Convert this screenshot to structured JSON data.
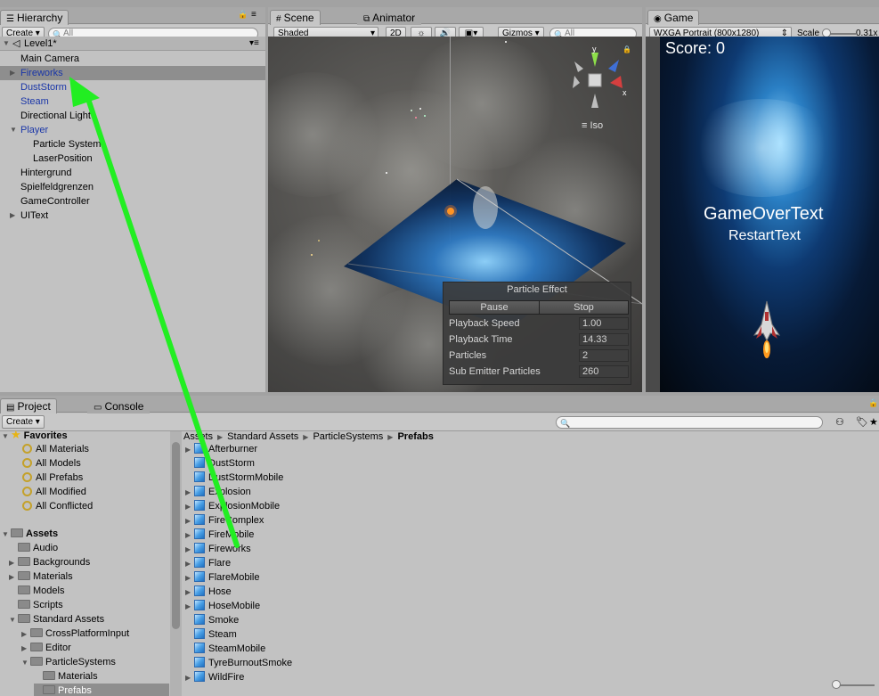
{
  "hierarchy": {
    "tab": "Hierarchy",
    "create": "Create",
    "search_placeholder": "All",
    "scene_name": "Level1*",
    "items": [
      {
        "label": "Main Camera",
        "indent": 0,
        "arrow": "",
        "color": "black"
      },
      {
        "label": "Fireworks",
        "indent": 0,
        "arrow": "right",
        "color": "blue",
        "selected": true
      },
      {
        "label": "DustStorm",
        "indent": 0,
        "arrow": "",
        "color": "blue"
      },
      {
        "label": "Steam",
        "indent": 0,
        "arrow": "",
        "color": "blue"
      },
      {
        "label": "Directional Light",
        "indent": 0,
        "arrow": "",
        "color": "black"
      },
      {
        "label": "Player",
        "indent": 0,
        "arrow": "down",
        "color": "blue"
      },
      {
        "label": "Particle System",
        "indent": 1,
        "arrow": "",
        "color": "black"
      },
      {
        "label": "LaserPosition",
        "indent": 1,
        "arrow": "",
        "color": "black"
      },
      {
        "label": "Hintergrund",
        "indent": 0,
        "arrow": "",
        "color": "black"
      },
      {
        "label": "Spielfeldgrenzen",
        "indent": 0,
        "arrow": "",
        "color": "black"
      },
      {
        "label": "GameController",
        "indent": 0,
        "arrow": "",
        "color": "black"
      },
      {
        "label": "UIText",
        "indent": 0,
        "arrow": "right",
        "color": "black"
      }
    ]
  },
  "scene": {
    "tab": "Scene",
    "tab2": "Animator",
    "shading": "Shaded",
    "mode_2d": "2D",
    "gizmos": "Gizmos",
    "search_placeholder": "All",
    "projection": "Iso",
    "axis_y": "y",
    "axis_x": "x",
    "particle_effect": {
      "title": "Particle Effect",
      "pause": "Pause",
      "stop": "Stop",
      "rows": [
        {
          "label": "Playback Speed",
          "value": "1.00"
        },
        {
          "label": "Playback Time",
          "value": "14.33"
        },
        {
          "label": "Particles",
          "value": "2"
        },
        {
          "label": "Sub Emitter Particles",
          "value": "260"
        }
      ]
    }
  },
  "game": {
    "tab": "Game",
    "resolution": "WXGA Portrait (800x1280)",
    "scale_label": "Scale",
    "scale_value": "0.31x",
    "score": "Score: 0",
    "gameover": "GameOverText",
    "restart": "RestartText"
  },
  "project": {
    "tab": "Project",
    "tab2": "Console",
    "create": "Create",
    "favorites_label": "Favorites",
    "favorites": [
      "All Materials",
      "All Models",
      "All Prefabs",
      "All Modified",
      "All Conflicted"
    ],
    "assets_label": "Assets",
    "tree": [
      {
        "label": "Audio",
        "depth": 1,
        "arrow": ""
      },
      {
        "label": "Backgrounds",
        "depth": 1,
        "arrow": "right"
      },
      {
        "label": "Materials",
        "depth": 1,
        "arrow": "right"
      },
      {
        "label": "Models",
        "depth": 1,
        "arrow": ""
      },
      {
        "label": "Scripts",
        "depth": 1,
        "arrow": ""
      },
      {
        "label": "Standard Assets",
        "depth": 1,
        "arrow": "down"
      },
      {
        "label": "CrossPlatformInput",
        "depth": 2,
        "arrow": "right"
      },
      {
        "label": "Editor",
        "depth": 2,
        "arrow": "right"
      },
      {
        "label": "ParticleSystems",
        "depth": 2,
        "arrow": "down"
      },
      {
        "label": "Materials",
        "depth": 3,
        "arrow": ""
      },
      {
        "label": "Prefabs",
        "depth": 3,
        "arrow": "",
        "selected": true
      }
    ],
    "breadcrumb": [
      "Assets",
      "Standard Assets",
      "ParticleSystems",
      "Prefabs"
    ],
    "files": [
      {
        "label": "Afterburner",
        "arrow": true
      },
      {
        "label": "DustStorm",
        "arrow": false
      },
      {
        "label": "DustStormMobile",
        "arrow": false
      },
      {
        "label": "Explosion",
        "arrow": true
      },
      {
        "label": "ExplosionMobile",
        "arrow": true
      },
      {
        "label": "FireComplex",
        "arrow": true
      },
      {
        "label": "FireMobile",
        "arrow": true
      },
      {
        "label": "Fireworks",
        "arrow": true
      },
      {
        "label": "Flare",
        "arrow": true
      },
      {
        "label": "FlareMobile",
        "arrow": true
      },
      {
        "label": "Hose",
        "arrow": true
      },
      {
        "label": "HoseMobile",
        "arrow": true
      },
      {
        "label": "Smoke",
        "arrow": false
      },
      {
        "label": "Steam",
        "arrow": false
      },
      {
        "label": "SteamMobile",
        "arrow": false
      },
      {
        "label": "TyreBurnoutSmoke",
        "arrow": false
      },
      {
        "label": "WildFire",
        "arrow": true
      }
    ]
  },
  "colors": {
    "annotation_arrow": "#22ee22",
    "selection": "#8e8e8e",
    "prefab_blue": "#1a36a8"
  }
}
